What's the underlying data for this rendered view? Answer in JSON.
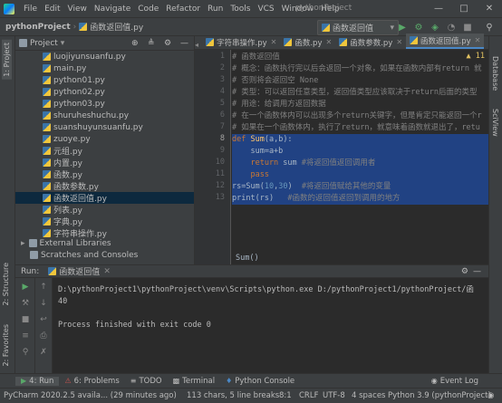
{
  "menu": {
    "items": [
      "File",
      "Edit",
      "View",
      "Navigate",
      "Code",
      "Refactor",
      "Run",
      "Tools",
      "VCS",
      "Window",
      "Help"
    ],
    "window_title": "pythonProject"
  },
  "navbar": {
    "project": "pythonProject",
    "file": "函数返回值.py",
    "run_config": "函数返回值"
  },
  "project_panel": {
    "title": "Project",
    "files": [
      "luojiyunsuanfu.py",
      "main.py",
      "python01.py",
      "python02.py",
      "python03.py",
      "shuruheshuchu.py",
      "suanshuyunsuanfu.py",
      "zuoye.py",
      "元组.py",
      "内置.py",
      "函数.py",
      "函数参数.py",
      "函数返回值.py",
      "列表.py",
      "字典.py",
      "字符串操作.py"
    ],
    "selected_index": 12,
    "external_libraries": "External Libraries",
    "scratches": "Scratches and Consoles"
  },
  "left_stripe": {
    "project": "1: Project",
    "structure": "2: Structure",
    "favorites": "2: Favorites"
  },
  "right_stripe": {
    "database": "Database",
    "sciview": "SciView"
  },
  "editor_tabs": [
    {
      "label": "字符串操作.py",
      "active": false
    },
    {
      "label": "函数.py",
      "active": false
    },
    {
      "label": "函数参数.py",
      "active": false
    },
    {
      "label": "函数返回值.py",
      "active": true
    }
  ],
  "editor": {
    "warnings": "▲ 11",
    "line_numbers": [
      "1",
      "2",
      "3",
      "4",
      "5",
      "6",
      "7",
      "8",
      "9",
      "10",
      "11",
      "12",
      "13"
    ],
    "lines": [
      "# 函数返回值",
      "# 概念：函数执行完以后会返回一个对象，如果在函数内部有return 就",
      "# 否则将会返回空 None",
      "# 类型：可以返回任意类型，返回值类型应该取决于return后面的类型",
      "# 用途：给调用方返回数据",
      "# 在一个函数体内可以出现多个return关键字，但是肯定只能返回一个r",
      "# 如果在一个函数体内，执行了return，就意味着函数就退出了，retu",
      "def Sum(a,b):",
      "    sum=a+b",
      "    return sum #将返回值返回调用者",
      "    pass",
      "rs=Sum(10,30)  #将返回值赋给其他的变量",
      "print(rs)   #函数的返回值返回到调用的地方"
    ],
    "hint": "Sum()"
  },
  "run_panel": {
    "label": "Run:",
    "tab": "函数返回值",
    "console_lines": [
      "D:\\pythonProject1\\pythonProject\\venv\\Scripts\\python.exe D:/pythonProject1/pythonProject/函",
      "40",
      "",
      "Process finished with exit code 0"
    ]
  },
  "bottom_tabs": [
    "4: Run",
    "6: Problems",
    "TODO",
    "Terminal",
    "Python Console"
  ],
  "event_log": "Event Log",
  "status": {
    "left": "PyCharm 2020.2.5 availa... (29 minutes ago)",
    "chars": "113 chars, 5 line breaks",
    "position": "8:1",
    "line_sep": "CRLF",
    "encoding": "UTF-8",
    "indent": "4 spaces",
    "interpreter": "Python 3.9 (pythonProject)"
  },
  "colors": {
    "accent": "#4a88c7",
    "selection": "#214283",
    "keyword": "#cc7832",
    "function": "#ffc66d",
    "number": "#6897bb",
    "comment": "#808080"
  }
}
